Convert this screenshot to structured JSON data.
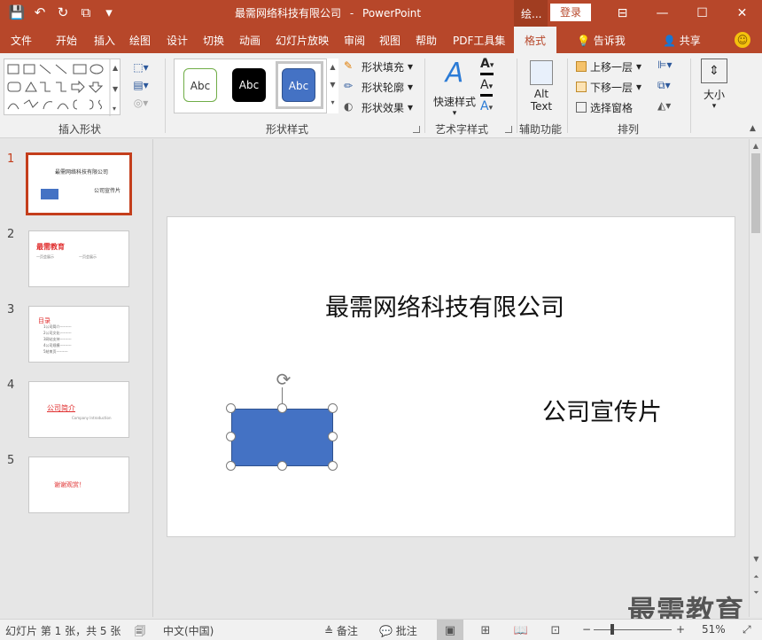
{
  "app": {
    "doc_title": "最需网络科技有限公司",
    "title_separator": "-",
    "app_name": "PowerPoint",
    "context_tab": "绘...",
    "login": "登录"
  },
  "qat": {
    "save": "💾",
    "undo": "↶",
    "redo": "↻",
    "present": "⧉",
    "customize": "▾"
  },
  "window_buttons": {
    "ribbon_options": "⊟",
    "minimize": "—",
    "maximize": "☐",
    "close": "✕"
  },
  "tabs": [
    "文件",
    "开始",
    "插入",
    "绘图",
    "设计",
    "切换",
    "动画",
    "幻灯片放映",
    "审阅",
    "视图",
    "帮助",
    "PDF工具集",
    "格式"
  ],
  "tell_me": "告诉我",
  "share": "共享",
  "ribbon": {
    "groups": [
      "插入形状",
      "形状样式",
      "艺术字样式",
      "辅助功能",
      "排列"
    ],
    "shape_styles": [
      "Abc",
      "Abc",
      "Abc"
    ],
    "shape_commands": {
      "fill": "形状填充",
      "outline": "形状轮廓",
      "effects": "形状效果"
    },
    "quick_styles": "快速样式",
    "alt_text_1": "Alt",
    "alt_text_2": "Text",
    "arrange": {
      "bring_forward": "上移一层",
      "send_backward": "下移一层",
      "selection_pane": "选择窗格"
    },
    "size": "大小"
  },
  "thumbnails": [
    {
      "num": "1",
      "title": "最需网络科技有限公司",
      "sub": "公司宣传片"
    },
    {
      "num": "2",
      "title": "最需教育",
      "sub": "一页会展示",
      "sub2": "一页会展示"
    },
    {
      "num": "3",
      "title": "目录",
      "items": [
        "1公司简介---------",
        "2公司文化---------",
        "3网站支持---------",
        "4公司规模---------",
        "5结束页---------"
      ]
    },
    {
      "num": "4",
      "title": "公司简介",
      "sub": "Company  Introduction"
    },
    {
      "num": "5",
      "title": "谢谢观赏！"
    }
  ],
  "slide": {
    "title": "最需网络科技有限公司",
    "subtitle": "公司宣传片"
  },
  "watermark": "最需教育",
  "statusbar": {
    "slide_info": "幻灯片 第 1 张，共 5 张",
    "language": "中文(中国)",
    "notes": "备注",
    "comments": "批注",
    "zoom": "51%"
  },
  "colors": {
    "accent": "#b7472a",
    "shape_fill": "#4472c4",
    "active_thumb": "#c43e1c"
  }
}
